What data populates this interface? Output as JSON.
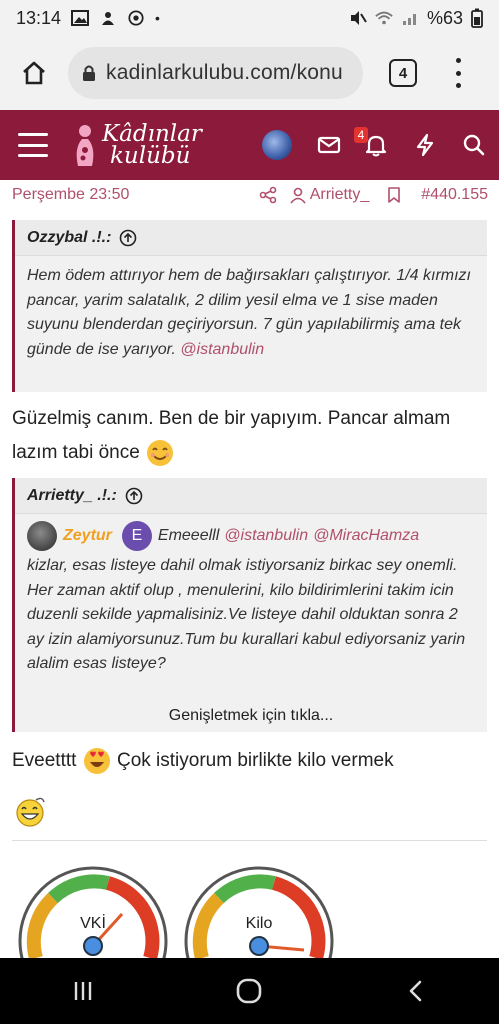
{
  "status_bar": {
    "time": "13:14",
    "battery": "%63"
  },
  "browser": {
    "url": "kadinlarkulubu.com/konu",
    "tab_count": "4"
  },
  "site": {
    "logo_line1": "Kâdınlar",
    "logo_line2": "kulübü",
    "notification_count": "4",
    "brand_color": "#8b1a3b"
  },
  "post": {
    "date": "Perşembe 23:50",
    "author": "Arrietty_",
    "number": "#440.155"
  },
  "quote1": {
    "author": "Ozzybal .!.:",
    "text": "Hem ödem attırıyor hem de bağırsakları çalıştırıyor. 1/4 kırmızı pancar, yarim salatalık, 2 dilim yesil elma ve 1 sise maden suyunu blenderdan geçiriyorsun. 7 gün yapılabilirmiş ama tek günde de ise yarıyor.",
    "mention": "@istanbulin"
  },
  "reply1": {
    "text_line1": "Güzelmiş canım. Ben de bir yapıyım. Pancar almam",
    "text_line2": "lazım tabi önce"
  },
  "quote2": {
    "author": "Arrietty_ .!.:",
    "zeytur": "Zeytur",
    "avatar_letter": "E",
    "emeeelll": "Emeeelll",
    "mention1": "@istanbulin",
    "mention2": "@MiracHamza",
    "text1": "kizlar, esas listeye dahil olmak istiyorsaniz birkac sey onemli.",
    "text2": "Her zaman aktif olup , menulerini, kilo bildirimlerini takim icin duzenli sekilde yapmalisiniz.Ve listeye dahil olduktan sonra 2 ay izin alamiyorsunuz.Tum bu kurallari kabul ediyorsaniz yarin alalim esas listeye?",
    "expand": "Genişletmek için tıkla..."
  },
  "reply2": {
    "text_start": "Eveetttt",
    "text_end": "Çok istiyorum birlikte kilo vermek"
  },
  "gauges": {
    "left_label": "VKİ",
    "right_label": "Kilo"
  }
}
